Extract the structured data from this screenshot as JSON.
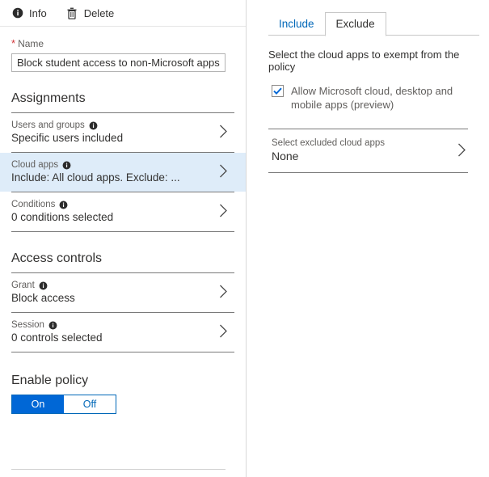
{
  "toolbar": {
    "info_label": "Info",
    "info_icon": "info-circle-icon",
    "delete_label": "Delete",
    "delete_icon": "trash-icon"
  },
  "name_field": {
    "required_marker": "*",
    "label": "Name",
    "value": "Block student access to non-Microsoft apps",
    "placeholder": "Name"
  },
  "assignments": {
    "heading": "Assignments",
    "rows": [
      {
        "label": "Users and groups",
        "value": "Specific users included",
        "info_icon": "info-circle-icon",
        "chevron_icon": "chevron-right-icon",
        "selected": false
      },
      {
        "label": "Cloud apps",
        "value": "Include: All cloud apps. Exclude: ...",
        "info_icon": "info-circle-icon",
        "chevron_icon": "chevron-right-icon",
        "selected": true
      },
      {
        "label": "Conditions",
        "value": "0 conditions selected",
        "info_icon": "info-circle-icon",
        "chevron_icon": "chevron-right-icon",
        "selected": false
      }
    ]
  },
  "access_controls": {
    "heading": "Access controls",
    "rows": [
      {
        "label": "Grant",
        "value": "Block access",
        "info_icon": "info-circle-icon",
        "chevron_icon": "chevron-right-icon"
      },
      {
        "label": "Session",
        "value": "0 controls selected",
        "info_icon": "info-circle-icon",
        "chevron_icon": "chevron-right-icon"
      }
    ]
  },
  "enable_policy": {
    "heading": "Enable policy",
    "on_label": "On",
    "off_label": "Off",
    "selected": "On"
  },
  "detail_panel": {
    "tabs": [
      {
        "label": "Include",
        "active": false
      },
      {
        "label": "Exclude",
        "active": true
      }
    ],
    "description": "Select the cloud apps to exempt from the policy",
    "checkbox": {
      "checked": true,
      "label": "Allow Microsoft cloud, desktop and mobile apps (preview)",
      "check_icon": "checkmark-icon"
    },
    "row": {
      "label": "Select excluded cloud apps",
      "value": "None",
      "chevron_icon": "chevron-right-icon"
    }
  },
  "colors": {
    "accent_blue": "#0067b8",
    "toggle_on_blue": "#0067d6",
    "selected_row_blue": "#deecf9",
    "required_red": "#d13438",
    "secondary_text": "#605e5c",
    "primary_text": "#323130"
  }
}
